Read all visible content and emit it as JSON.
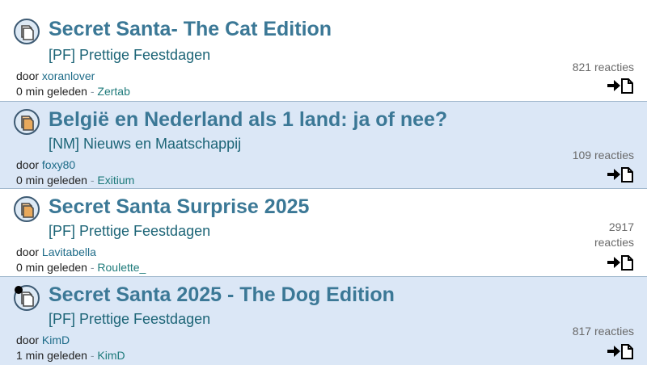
{
  "topics": [
    {
      "title": "Secret Santa- The Cat Edition",
      "forum": "[PF] Prettige Feestdagen",
      "by_label": "door",
      "author": "xoranlover",
      "time": "0 min geleden",
      "separator": "-",
      "last_poster": "Zertab",
      "reactions_line1": "821 reacties",
      "reactions_line2": "",
      "icon": "speech-bubble-icon"
    },
    {
      "title": "België en Nederland als 1 land: ja of nee?",
      "forum": "[NM] Nieuws en Maatschappij",
      "by_label": "door",
      "author": "foxy80",
      "time": "0 min geleden",
      "separator": "-",
      "last_poster": "Exitium",
      "reactions_line1": "109 reacties",
      "reactions_line2": "",
      "icon": "speech-bubble-orange-icon"
    },
    {
      "title": "Secret Santa Surprise 2025",
      "forum": "[PF] Prettige Feestdagen",
      "by_label": "door",
      "author": "Lavitabella",
      "time": "0 min geleden",
      "separator": "-",
      "last_poster": "Roulette_",
      "reactions_line1": "2917",
      "reactions_line2": "reacties",
      "icon": "speech-bubble-orange-icon"
    },
    {
      "title": "Secret Santa 2025 - The Dog Edition",
      "forum": "[PF] Prettige Feestdagen",
      "by_label": "door",
      "author": "KimD",
      "time": "1 min geleden",
      "separator": "-",
      "last_poster": "KimD",
      "reactions_line1": "817 reacties",
      "reactions_line2": "",
      "icon": "speech-bubble-dot-icon"
    }
  ],
  "colors": {
    "accent": "#5b97c4",
    "title": "#3b7896",
    "row_alt": "#dbe7f6"
  }
}
